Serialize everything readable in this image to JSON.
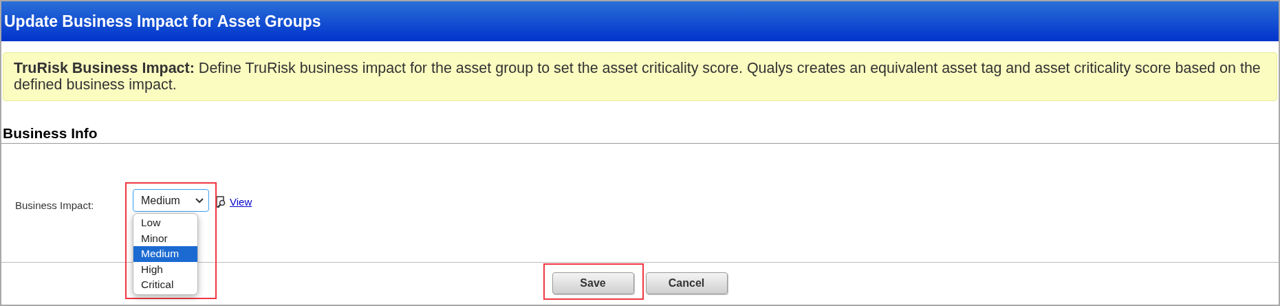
{
  "window": {
    "title": "Update Business Impact for Asset Groups"
  },
  "notice": {
    "text": "**TruRisk Business Impact:** Define TruRisk business impact for the asset group to set the asset criticality score. Qualys creates an equivalent asset tag and asset criticality score based on the defined business impact."
  },
  "section": {
    "title": "Business Info"
  },
  "field": {
    "label": "Business Impact:",
    "value": "Medium",
    "highlighted": true,
    "expanded": true,
    "options": [
      {
        "label": "Low",
        "selected": false
      },
      {
        "label": "Minor",
        "selected": false
      },
      {
        "label": "Medium",
        "selected": true
      },
      {
        "label": "High",
        "selected": false
      },
      {
        "label": "Critical",
        "selected": false
      }
    ]
  },
  "link": {
    "label": "View"
  },
  "buttons": [
    {
      "label": "Save",
      "highlighted": true
    },
    {
      "label": "Cancel",
      "highlighted": false
    }
  ]
}
